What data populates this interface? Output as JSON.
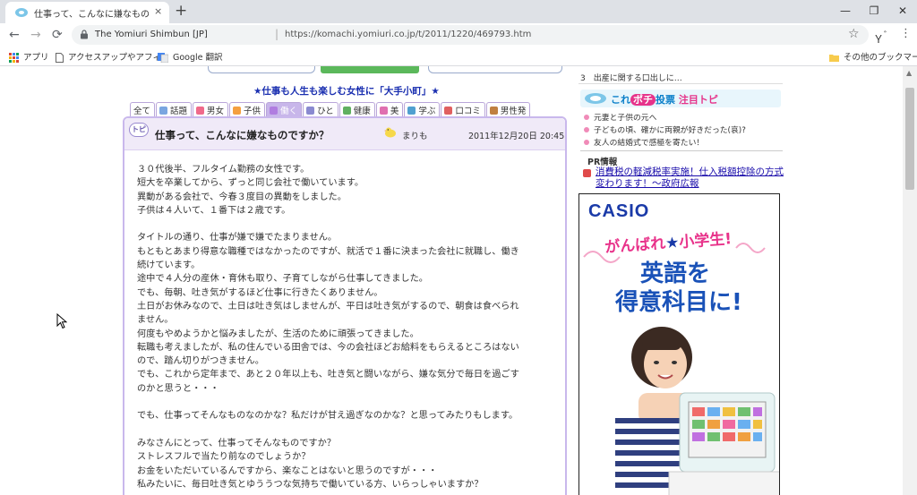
{
  "browser": {
    "tab_title": "仕事って、こんなに嫌なものですか？",
    "tab_close": "×",
    "new_tab": "+",
    "window_controls": [
      "—",
      "❐",
      "✕"
    ],
    "nav": {
      "back": "←",
      "forward": "→",
      "reload": "⟳"
    },
    "site_name": "The Yomiuri Shimbun [JP]",
    "separator": "|",
    "url": "https://komachi.yomiuri.co.jp/t/2011/1220/469793.htm",
    "star": "☆",
    "menu": "⋮",
    "ext_glyph": "ﾞ",
    "bookmarks": [
      {
        "label": "アプリ",
        "icon": "apps-grid-icon"
      },
      {
        "label": "アクセスアップやアフィ...",
        "icon": "page-icon"
      },
      {
        "label": "Google 翻訳",
        "icon": "google-translate-icon"
      }
    ],
    "other_bookmarks": "その他のブックマーク"
  },
  "page": {
    "slogan": "★仕事も人生も楽しむ女性に「大手小町」★",
    "categories": [
      {
        "label": "全て",
        "color": "#ffffff"
      },
      {
        "label": "話題",
        "color": "#7aa6e0"
      },
      {
        "label": "男女",
        "color": "#f06a8a"
      },
      {
        "label": "子供",
        "color": "#f4a040"
      },
      {
        "label": "働く",
        "color": "#b07de0",
        "active": true
      },
      {
        "label": "ひと",
        "color": "#8a8ad0"
      },
      {
        "label": "健康",
        "color": "#60b060"
      },
      {
        "label": "美",
        "color": "#e070b0"
      },
      {
        "label": "学ぶ",
        "color": "#50a0d0"
      },
      {
        "label": "口コミ",
        "color": "#e06060"
      },
      {
        "label": "男性発",
        "color": "#c08040"
      }
    ],
    "topic": {
      "badge": "トピ",
      "title": "仕事って、こんなに嫌なものですか？",
      "author": "まりも",
      "date": "2011年12月20日 20:45",
      "paragraphs": [
        [
          "３０代後半、フルタイム勤務の女性です。",
          "短大を卒業してから、ずっと同じ会社で働いています。",
          "異動がある会社で、今春３度目の異動をしました。",
          "子供は４人いて、１番下は２歳です。"
        ],
        [
          "タイトルの通り、仕事が嫌で嫌でたまりません。",
          "もともとあまり得意な職種ではなかったのですが、就活で１番に決まった会社に就職し、働き",
          "続けています。",
          "途中で４人分の産休・育休も取り、子育てしながら仕事してきました。",
          "でも、毎朝、吐き気がするほど仕事に行きたくありません。",
          "土日がお休みなので、土日は吐き気はしませんが、平日は吐き気がするので、朝食は食べられ",
          "ません。",
          "何度もやめようかと悩みましたが、生活のために頑張ってきました。",
          "転職も考えましたが、私の住んでいる田舎では、今の会社ほどお給料をもらえるところはない",
          "ので、踏ん切りがつきません。",
          "でも、これから定年まで、あと２０年以上も、吐き気と闘いながら、嫌な気分で毎日を過ごす",
          "のかと思うと・・・"
        ],
        [
          "でも、仕事ってそんなものなのかな？私だけが甘え過ぎなのかな？と思ってみたりもします。"
        ],
        [
          "みなさんにとって、仕事ってそんなものですか？",
          "ストレスフルで当たり前なのでしょうか？",
          "お金をいただいているんですから、楽なことはないと思うのですが・・・",
          "私みたいに、毎日吐き気とゆううつな気持ちで働いている方、いらっしゃいますか？"
        ]
      ]
    }
  },
  "sidebar": {
    "rank_item": "3　出産に関する口出しに…",
    "kore_header": {
      "pre": "これ",
      "pochi": "ポチ",
      "mid": "投票 ",
      "hot": "注目トピ"
    },
    "kore_items": [
      "元妻と子供の元へ",
      "子どもの頃、確かに両親が好きだった(哀)?",
      "友人の結婚式で感極を寄たい！"
    ],
    "pr_label": "PR情報",
    "pr_link": "消費税の軽減税率実施！仕入税額控除の方式変わります！～政府広報",
    "ad": {
      "brand": "CASIO",
      "line1_a": "がんばれ",
      "line1_star": "★",
      "line1_b": "小学生!",
      "line2": "英語を",
      "line3": "得意科目に!"
    }
  },
  "scroll": {
    "up": "▲"
  }
}
